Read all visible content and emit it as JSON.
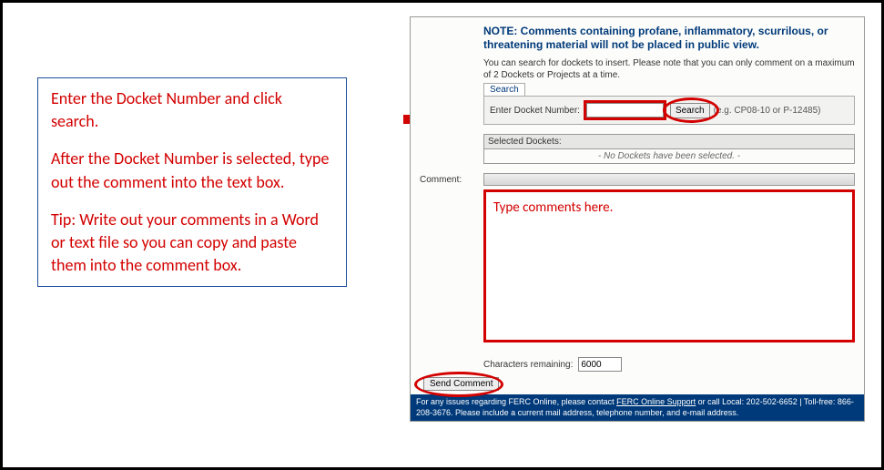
{
  "instructions": {
    "p1": "Enter the Docket Number and click search.",
    "p2": "After the Docket Number is selected, type out the comment into the text box.",
    "p3": "Tip: Write out your comments in a Word or text file so you can copy and paste them into the comment box."
  },
  "form": {
    "note_heading": "NOTE: Comments containing profane, inflammatory, scurrilous, or threatening material will not be placed in public view.",
    "subnote": "You can search for dockets to insert. Please note that you can only comment on a maximum of 2 Dockets or Projects at a time.",
    "search_tab": "Search",
    "docket_label": "Enter Docket Number:",
    "docket_value": "",
    "search_button": "Search",
    "example": "(e.g. CP08-10 or P-12485)",
    "selected_header": "Selected Dockets:",
    "selected_empty": "- No Dockets have been selected. -",
    "comment_label": "Comment:",
    "comment_placeholder": "Type comments here.",
    "chars_label": "Characters remaining:",
    "chars_value": "6000",
    "send_button": "Send Comment",
    "footer_prefix": "For any issues regarding FERC Online, please contact ",
    "footer_link": "FERC Online Support",
    "footer_suffix": " or call Local: 202-502-6652 | Toll-free: 866-208-3676. Please include a current mail address, telephone number, and e-mail address."
  }
}
